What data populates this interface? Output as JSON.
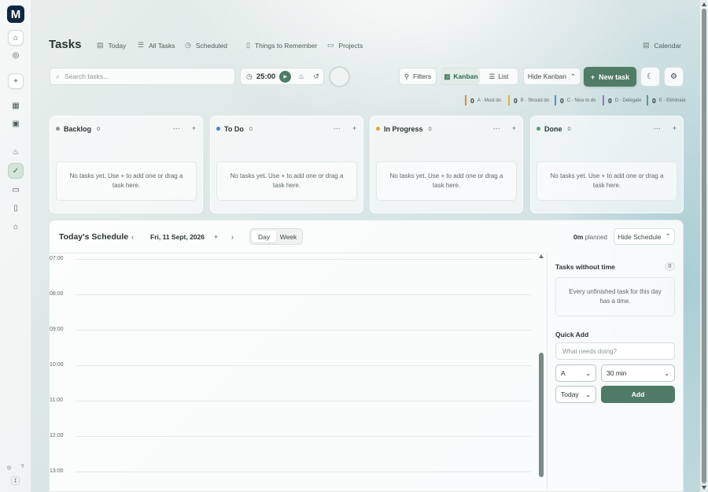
{
  "app": {
    "logo_letter": "M",
    "title": "Tasks"
  },
  "nav": {
    "today": "Today",
    "all_tasks": "All Tasks",
    "scheduled": "Scheduled",
    "things_to_remember": "Things to Remember",
    "projects": "Projects",
    "calendar": "Calendar"
  },
  "toolbar": {
    "search_placeholder": "Search tasks...",
    "timer_value": "25:00",
    "filters": "Filters",
    "kanban": "Kanban",
    "list": "List",
    "hide_kanban": "Hide Kanban",
    "new_task": "New task"
  },
  "priorities": [
    {
      "count": "0",
      "label": "A · Must do",
      "color": "#e08a3c"
    },
    {
      "count": "0",
      "label": "B · Should do",
      "color": "#d9b23a"
    },
    {
      "count": "0",
      "label": "C · Nice to do",
      "color": "#4d8fd0"
    },
    {
      "count": "0",
      "label": "D · Delegate",
      "color": "#9c6fcf"
    },
    {
      "count": "0",
      "label": "E · Eliminate",
      "color": "#4fa08a"
    }
  ],
  "columns": [
    {
      "title": "Backlog",
      "count": "0",
      "dot": "#8a9896",
      "empty": "No tasks yet. Use + to add one or drag a task here."
    },
    {
      "title": "To Do",
      "count": "0",
      "dot": "#4d7fd6",
      "empty": "No tasks yet. Use + to add one or drag a task here."
    },
    {
      "title": "In Progress",
      "count": "0",
      "dot": "#e0a23c",
      "empty": "No tasks yet. Use + to add one or drag a task here."
    },
    {
      "title": "Done",
      "count": "0",
      "dot": "#4fa06e",
      "empty": "No tasks yet. Use + to add one or drag a task here."
    }
  ],
  "schedule": {
    "title": "Today's Schedule",
    "date": "Fri, 11 Sept, 2026",
    "day": "Day",
    "week": "Week",
    "planned_value": "0m",
    "planned_label": "planned",
    "hide_schedule": "Hide Schedule",
    "hours": [
      "07:00",
      "08:00",
      "09:00",
      "10:00",
      "11:00",
      "12:00",
      "13:00"
    ],
    "without_time_title": "Tasks without time",
    "without_time_count": "0",
    "without_time_note": "Every unfinished task for this day has a time.",
    "quick_add_title": "Quick Add",
    "quick_add_placeholder": "What needs doing?",
    "priority_value": "A",
    "duration_value": "30 min",
    "day_value": "Today",
    "add_label": "Add"
  }
}
